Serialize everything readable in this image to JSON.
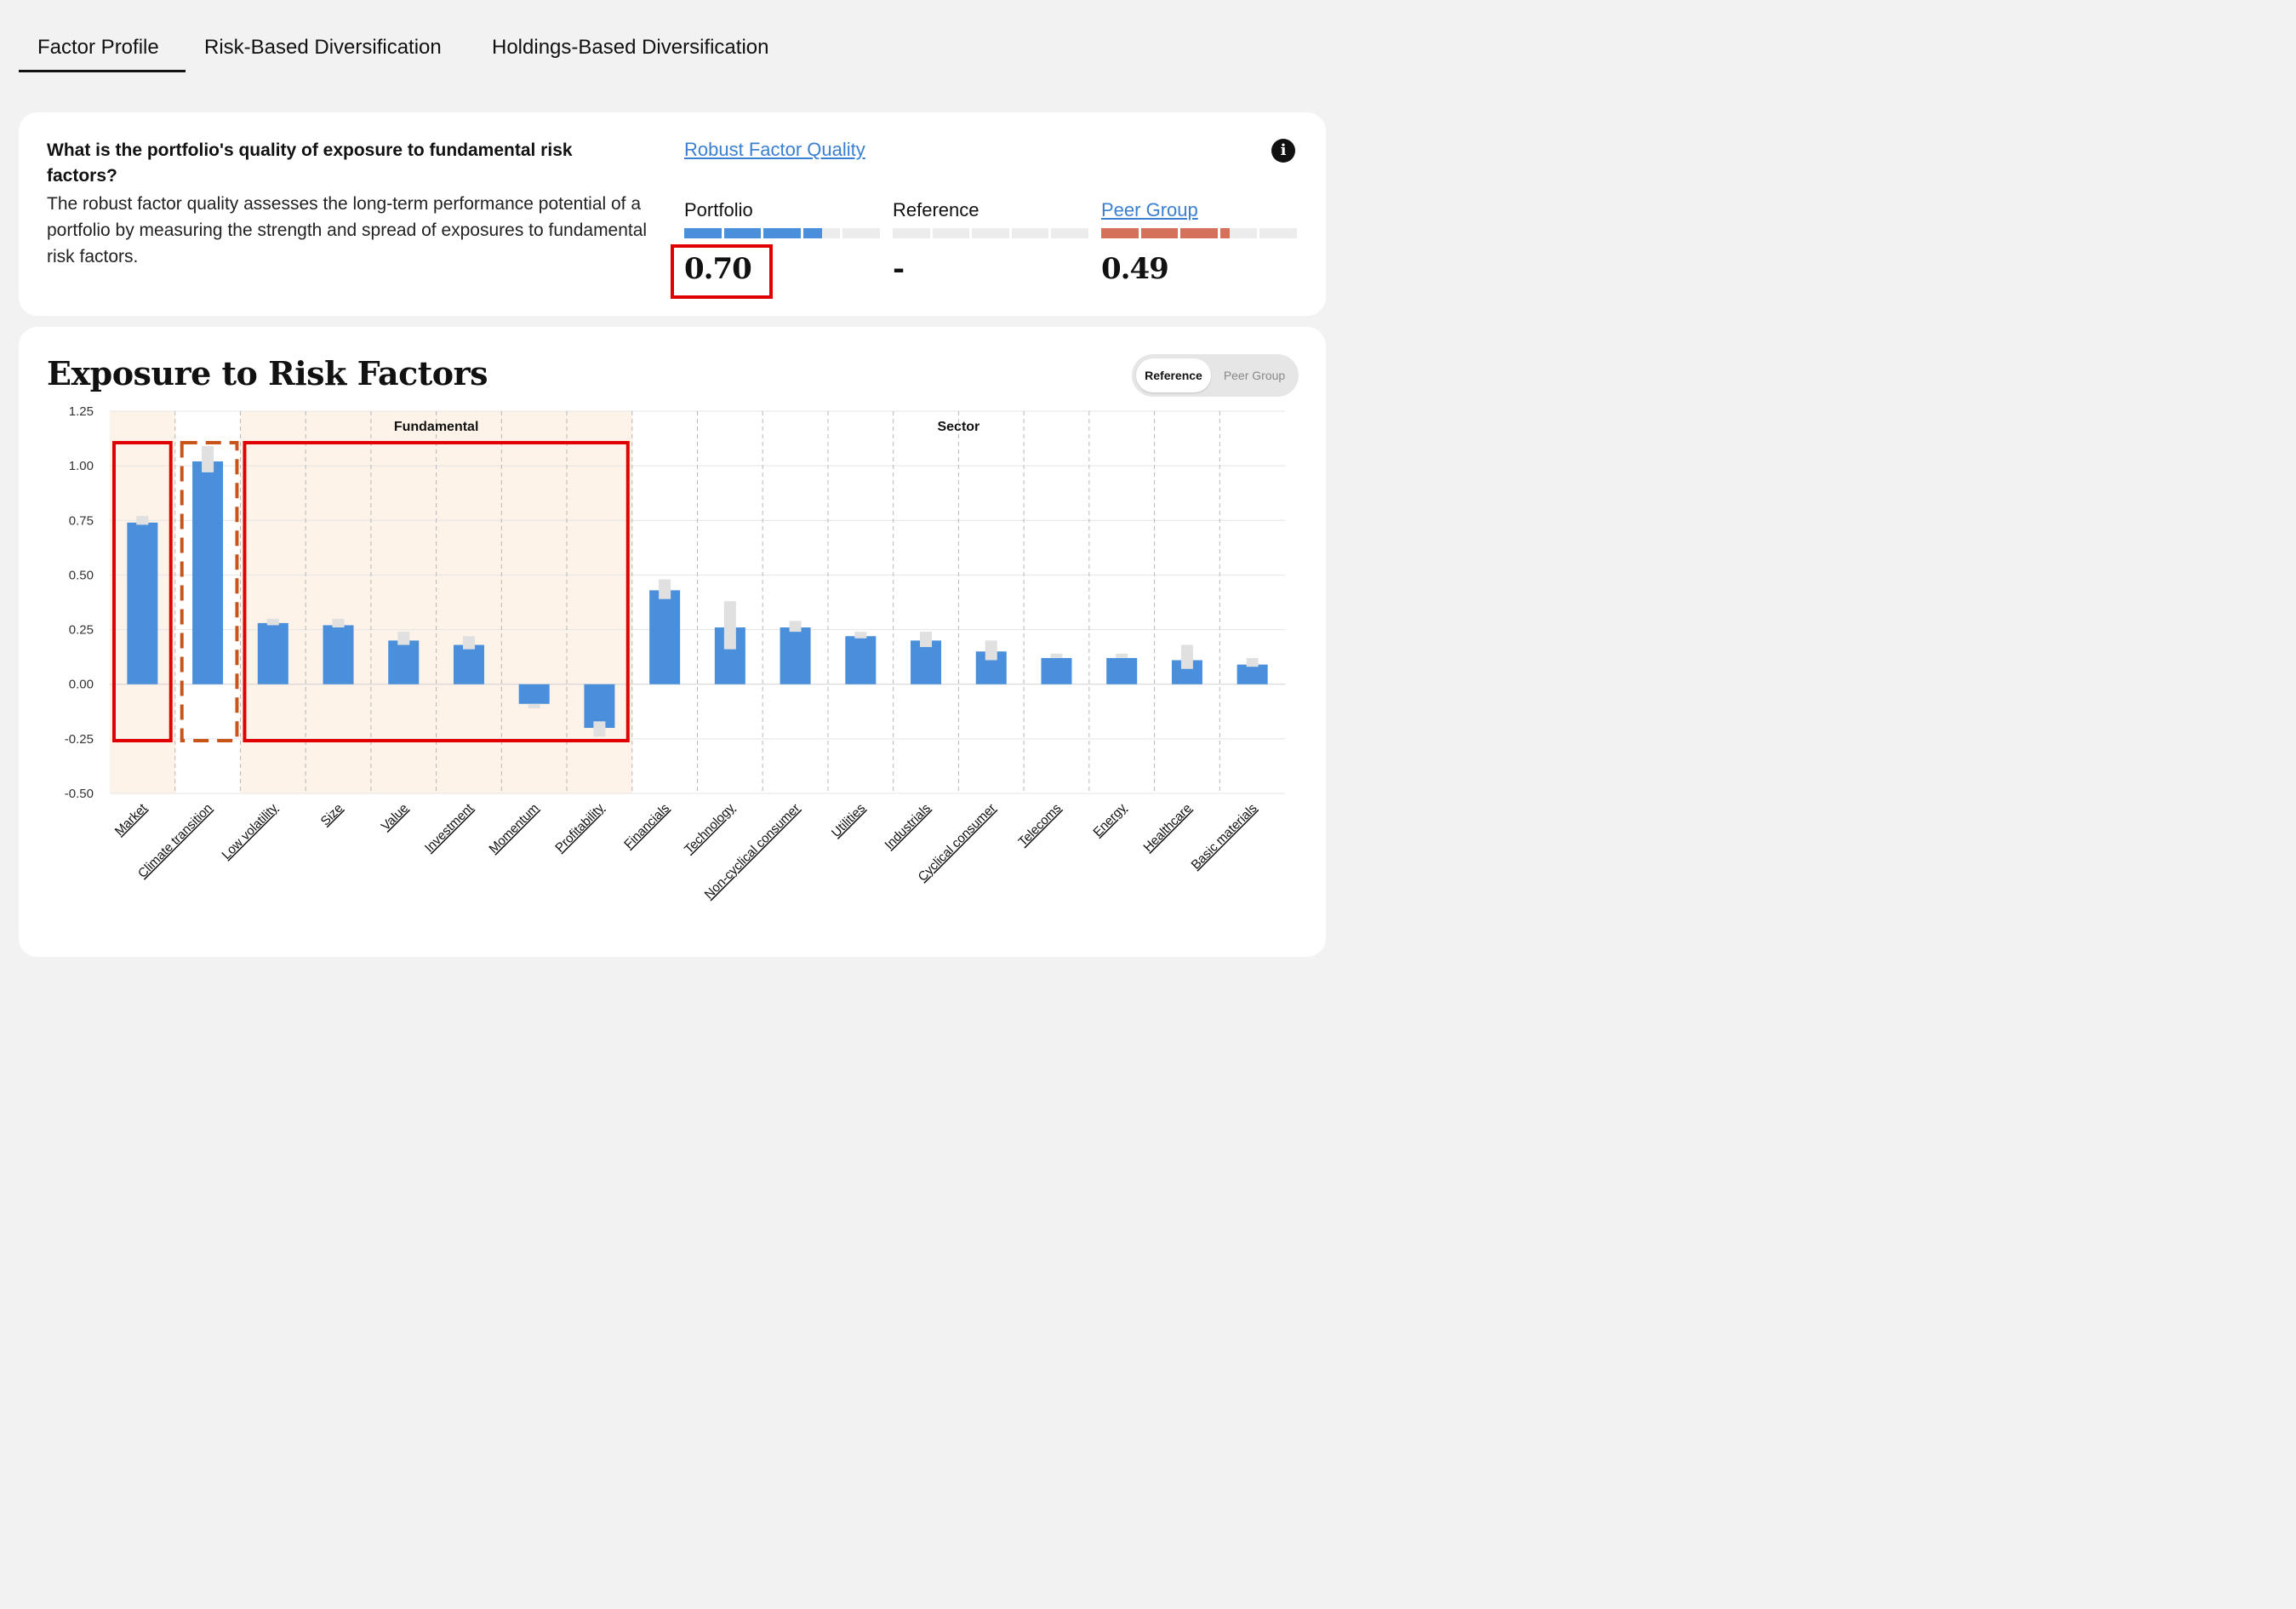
{
  "tabs": [
    {
      "label": "Factor Profile",
      "active": true
    },
    {
      "label": "Risk-Based Diversification",
      "active": false
    },
    {
      "label": "Holdings-Based Diversification",
      "active": false
    }
  ],
  "quality_card": {
    "question": "What is the portfolio's quality of exposure to fundamental risk factors?",
    "description": "The robust factor quality assesses the long-term performance potential of a portfolio by measuring the strength and spread of exposures to fundamental risk factors.",
    "link_label": "Robust Factor Quality",
    "info_icon": "info-icon",
    "metrics": {
      "portfolio": {
        "label": "Portfolio",
        "value": "0.70",
        "bar_level": 0.7,
        "color": "#4a8fdb"
      },
      "reference": {
        "label": "Reference",
        "value": "-",
        "bar_level": 0,
        "color": "#e8e8e8"
      },
      "peer_group": {
        "label": "Peer Group",
        "value": "0.49",
        "bar_level": 0.65,
        "color": "#d5705a"
      }
    }
  },
  "chart_card": {
    "title": "Exposure to Risk Factors",
    "toggle": {
      "reference_label": "Reference",
      "peer_group_label": "Peer Group",
      "selected": "Reference"
    }
  },
  "chart_data": {
    "type": "bar",
    "title": "Exposure to Risk Factors",
    "xlabel": "",
    "ylabel": "",
    "ylim": [
      -0.5,
      1.25
    ],
    "yticks": [
      1.25,
      1.0,
      0.75,
      0.5,
      0.25,
      0.0,
      -0.25,
      -0.5
    ],
    "ytick_labels": [
      "1.25",
      "1.00",
      "0.75",
      "0.50",
      "0.25",
      "0.00",
      "-0.25",
      "-0.50"
    ],
    "grid": true,
    "groups": [
      {
        "label": "Fundamental",
        "from": 2,
        "to": 7
      },
      {
        "label": "Sector",
        "from": 8,
        "to": 17
      }
    ],
    "shaded_categories": [
      "Market",
      "Low volatility",
      "Size",
      "Value",
      "Investment",
      "Momentum",
      "Profitability"
    ],
    "categories": [
      "Market",
      "Climate transition",
      "Low volatility",
      "Size",
      "Value",
      "Investment",
      "Momentum",
      "Profitability",
      "Financials",
      "Technology",
      "Non-cyclical consumer",
      "Utilities",
      "Industrials",
      "Cyclical consumer",
      "Telecoms",
      "Energy",
      "Healthcare",
      "Basic materials"
    ],
    "series": [
      {
        "values": [
          0.74,
          1.02,
          0.28,
          0.27,
          0.2,
          0.18,
          -0.09,
          -0.2,
          0.43,
          0.26,
          0.26,
          0.22,
          0.2,
          0.15,
          0.12,
          0.12,
          0.11,
          0.09
        ],
        "color": "#4a8fdb"
      },
      {
        "values": [
          0.74,
          1.06,
          0.28,
          0.28,
          0.22,
          0.2,
          -0.09,
          -0.2,
          0.44,
          0.28,
          0.26,
          0.23,
          0.21,
          0.17,
          0.14,
          0.13,
          0.13,
          0.11
        ],
        "color": "#e0e0e0",
        "range": [
          [
            0.73,
            0.77
          ],
          [
            0.97,
            1.09
          ],
          [
            0.27,
            0.3
          ],
          [
            0.26,
            0.3
          ],
          [
            0.18,
            0.24
          ],
          [
            0.16,
            0.22
          ],
          [
            -0.11,
            -0.09
          ],
          [
            -0.24,
            -0.17
          ],
          [
            0.39,
            0.48
          ],
          [
            0.16,
            0.38
          ],
          [
            0.24,
            0.29
          ],
          [
            0.21,
            0.24
          ],
          [
            0.17,
            0.24
          ],
          [
            0.11,
            0.2
          ],
          [
            0.12,
            0.14
          ],
          [
            0.12,
            0.14
          ],
          [
            0.07,
            0.18
          ],
          [
            0.08,
            0.12
          ]
        ]
      }
    ],
    "annotations": [
      {
        "type": "box",
        "style": "solid",
        "color": "#e00000",
        "categories": [
          "Market"
        ]
      },
      {
        "type": "box",
        "style": "dashed",
        "color": "#c9541a",
        "categories": [
          "Climate transition"
        ]
      },
      {
        "type": "box",
        "style": "solid",
        "color": "#e00000",
        "categories": [
          "Low volatility",
          "Size",
          "Value",
          "Investment",
          "Momentum",
          "Profitability"
        ]
      }
    ]
  }
}
